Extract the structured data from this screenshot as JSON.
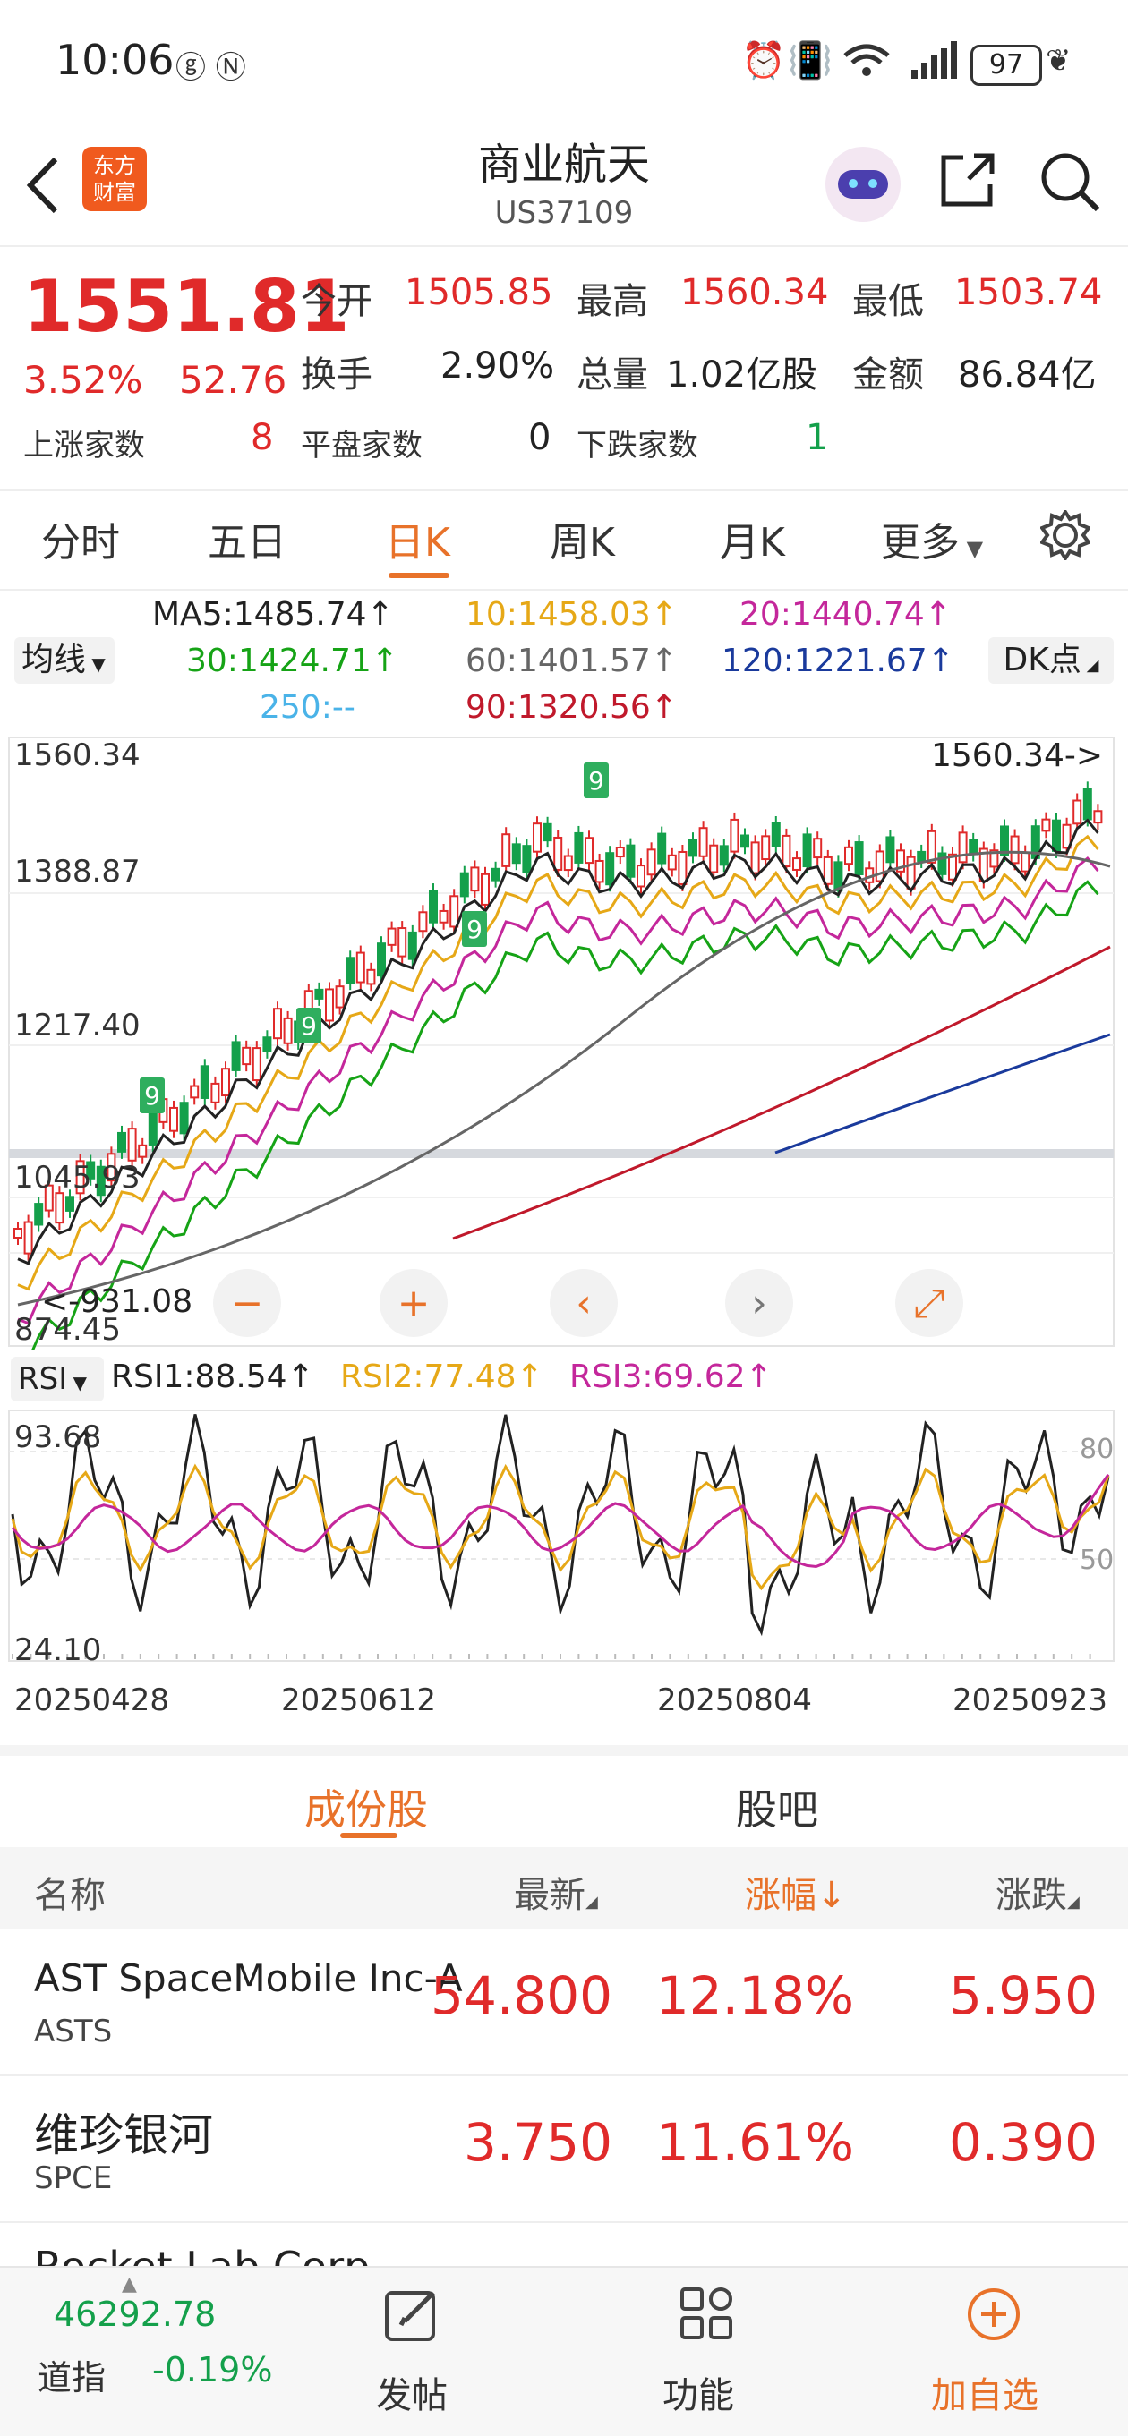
{
  "status": {
    "time": "10:06",
    "battery": "97"
  },
  "header": {
    "title": "商业航天",
    "code": "US37109",
    "logo_line1": "东方",
    "logo_line2": "财富"
  },
  "quote": {
    "price": "1551.81",
    "pct": "3.52%",
    "change": "52.76",
    "open_label": "今开",
    "open": "1505.85",
    "high_label": "最高",
    "high": "1560.34",
    "low_label": "最低",
    "low": "1503.74",
    "turnover_label": "换手",
    "turnover": "2.90%",
    "volume_label": "总量",
    "volume": "1.02亿股",
    "amount_label": "金额",
    "amount": "86.84亿",
    "up_label": "上涨家数",
    "up": "8",
    "flat_label": "平盘家数",
    "flat": "0",
    "down_label": "下跌家数",
    "down": "1"
  },
  "tabs": [
    "分时",
    "五日",
    "日K",
    "周K",
    "月K",
    "更多"
  ],
  "active_tab": "日K",
  "ma": {
    "selector": "均线",
    "ma5": "MA5:1485.74↑",
    "ma10": "10:1458.03↑",
    "ma20": "20:1440.74↑",
    "ma30": "30:1424.71↑",
    "ma60": "60:1401.57↑",
    "ma120": "120:1221.67↑",
    "ma250": "250:--",
    "ma90": "90:1320.56↑",
    "dk": "DK点",
    "colors": {
      "ma5": "#222222",
      "ma10": "#e6a817",
      "ma20": "#c4279b",
      "ma30": "#16a316",
      "ma60": "#666666",
      "ma120": "#1a3a9c",
      "ma250": "#4ab3e8",
      "ma90": "#c0192b"
    }
  },
  "kline": {
    "axis": [
      "1560.34",
      "1388.87",
      "1217.40",
      "1045.93",
      "874.45"
    ],
    "max_marker": "1560.34->",
    "min_marker": "<-931.08",
    "seq_nine": "9"
  },
  "rsi": {
    "selector": "RSI",
    "rsi1": "RSI1:88.54↑",
    "rsi2": "RSI2:77.48↑",
    "rsi3": "RSI3:69.62↑",
    "axis_top": "93.68",
    "axis_bottom": "24.10",
    "ref80": "80",
    "ref50": "50"
  },
  "dates": [
    "20250428",
    "20250612",
    "20250804",
    "20250923"
  ],
  "subtabs": {
    "constituents": "成份股",
    "forum": "股吧"
  },
  "table": {
    "headers": {
      "name": "名称",
      "latest": "最新",
      "pct": "涨幅↓",
      "change": "涨跌"
    },
    "rows": [
      {
        "name": "AST SpaceMobile Inc-A",
        "code": "ASTS",
        "latest": "54.800",
        "pct": "12.18%",
        "change": "5.950"
      },
      {
        "name": "维珍银河",
        "code": "SPCE",
        "latest": "3.750",
        "pct": "11.61%",
        "change": "0.390"
      },
      {
        "name": "Rocket Lab Corp",
        "code": "",
        "latest": "",
        "pct": "",
        "change": ""
      }
    ]
  },
  "bottom": {
    "index_value": "46292.78",
    "index_name": "道指",
    "index_pct": "-0.19%",
    "post": "发帖",
    "func": "功能",
    "add": "加自选"
  }
}
